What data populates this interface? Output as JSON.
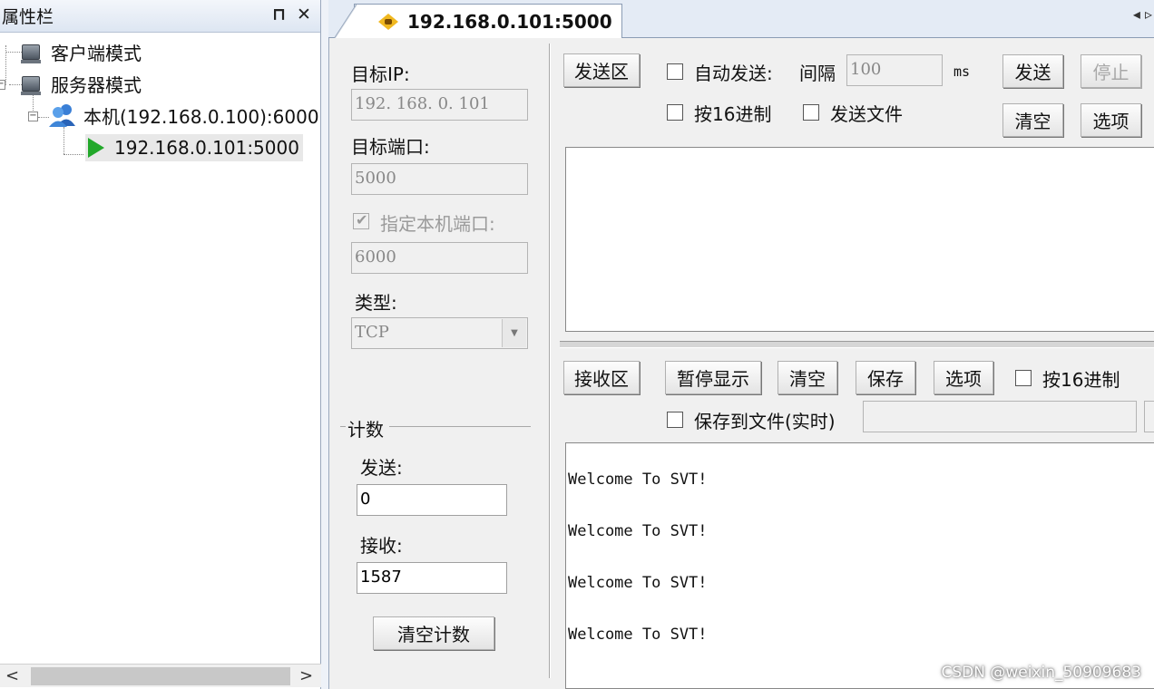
{
  "left_panel": {
    "title": "属性栏",
    "pin_glyph": "ᵖ",
    "close_glyph": "✕",
    "tree": {
      "client_mode": "客户端模式",
      "server_mode": "服务器模式",
      "local_host": "本机(192.168.0.100):6000",
      "connection": "192.168.0.101:5000"
    }
  },
  "tab": {
    "title": "192.168.0.101:5000"
  },
  "settings": {
    "target_ip_label": "目标IP:",
    "target_ip_value": "192. 168. 0. 101",
    "target_port_label": "目标端口:",
    "target_port_value": "5000",
    "local_port_check_label": "指定本机端口:",
    "local_port_value": "6000",
    "type_label": "类型:",
    "type_value": "TCP",
    "count_group_label": "计数",
    "send_count_label": "发送:",
    "send_count_value": "0",
    "recv_count_label": "接收:",
    "recv_count_value": "1587",
    "clear_count_button": "清空计数"
  },
  "send": {
    "section_button": "发送区",
    "auto_send_label": "自动发送:",
    "interval_label": "间隔",
    "interval_value": "100",
    "interval_unit": "ms",
    "send_button": "发送",
    "stop_button": "停止",
    "hex_label": "按16进制",
    "send_file_label": "发送文件",
    "clear_button": "清空",
    "options_button": "选项"
  },
  "receive": {
    "section_button": "接收区",
    "pause_button": "暂停显示",
    "clear_button": "清空",
    "save_button": "保存",
    "options_button": "选项",
    "hex_label": "按16进制",
    "save_to_file_label": "保存到文件(实时)",
    "lines": [
      "Welcome To SVT!",
      "Welcome To SVT!",
      "Welcome To SVT!",
      "Welcome To SVT!"
    ]
  },
  "watermark": "CSDN @weixin_50909683"
}
